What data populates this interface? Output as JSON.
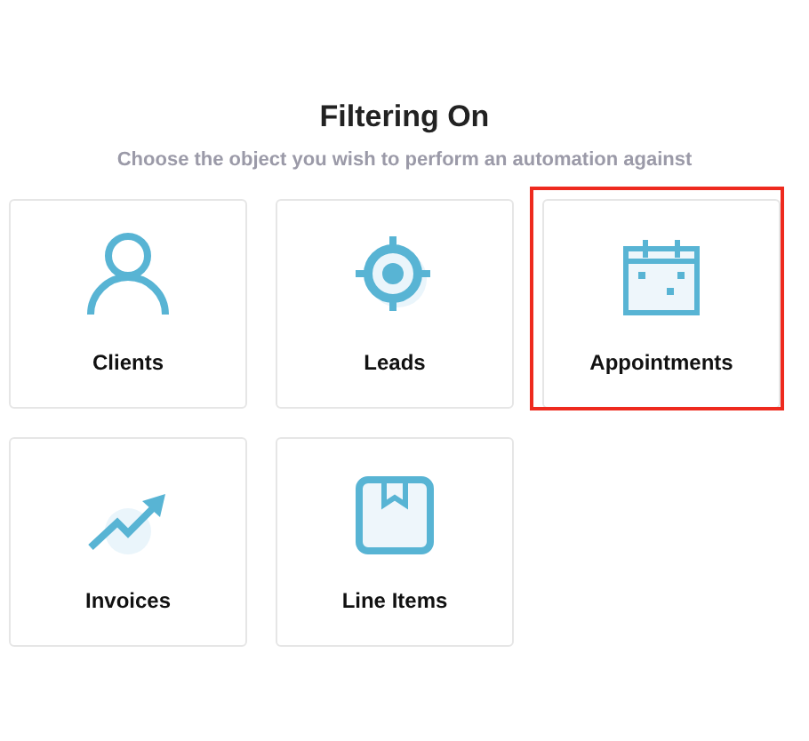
{
  "title": "Filtering On",
  "subtitle": "Choose the object you wish to perform an automation against",
  "objects": [
    {
      "label": "Clients",
      "kind": "person",
      "highlighted": false
    },
    {
      "label": "Leads",
      "kind": "target",
      "highlighted": false
    },
    {
      "label": "Appointments",
      "kind": "calendar",
      "highlighted": true
    },
    {
      "label": "Invoices",
      "kind": "trend",
      "highlighted": false
    },
    {
      "label": "Line Items",
      "kind": "box",
      "highlighted": false
    }
  ]
}
